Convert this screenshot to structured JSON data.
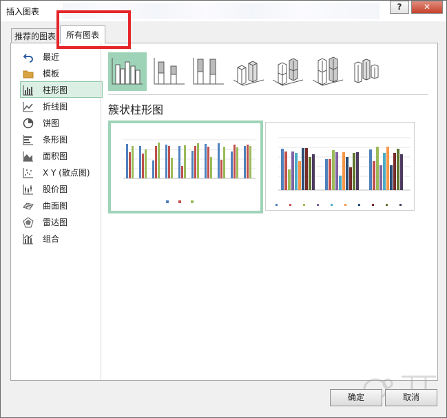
{
  "dialog": {
    "title": "插入图表",
    "help_label": "?",
    "close_label": "✕"
  },
  "tabs": [
    {
      "label": "推荐的图表"
    },
    {
      "label": "所有图表",
      "active": true
    }
  ],
  "sidebar": {
    "items": [
      {
        "label": "最近",
        "icon": "undo-arrow-icon"
      },
      {
        "label": "模板",
        "icon": "folder-icon"
      },
      {
        "label": "柱形图",
        "icon": "column-chart-icon",
        "selected": true
      },
      {
        "label": "折线图",
        "icon": "line-chart-icon"
      },
      {
        "label": "饼图",
        "icon": "pie-chart-icon"
      },
      {
        "label": "条形图",
        "icon": "bar-chart-icon"
      },
      {
        "label": "面积图",
        "icon": "area-chart-icon"
      },
      {
        "label": "X Y (散点图)",
        "icon": "scatter-chart-icon"
      },
      {
        "label": "股价图",
        "icon": "stock-chart-icon"
      },
      {
        "label": "曲面图",
        "icon": "surface-chart-icon"
      },
      {
        "label": "雷达图",
        "icon": "radar-chart-icon"
      },
      {
        "label": "组合",
        "icon": "combo-chart-icon"
      }
    ]
  },
  "chart_subtypes": {
    "selected_title": "簇状柱形图",
    "icons": [
      "clustered-column-icon",
      "stacked-column-icon",
      "100-stacked-column-icon",
      "3d-clustered-column-icon",
      "3d-stacked-column-icon",
      "3d-100-stacked-column-icon",
      "3d-column-icon"
    ]
  },
  "colors": {
    "accent_green": "#9fd3b7",
    "series_blue": "#4f81bd",
    "series_red": "#c0504d",
    "series_green": "#9bbb59",
    "red_highlight": "#e5252a"
  },
  "buttons": {
    "ok_label": "确定",
    "cancel_label": "取消"
  }
}
